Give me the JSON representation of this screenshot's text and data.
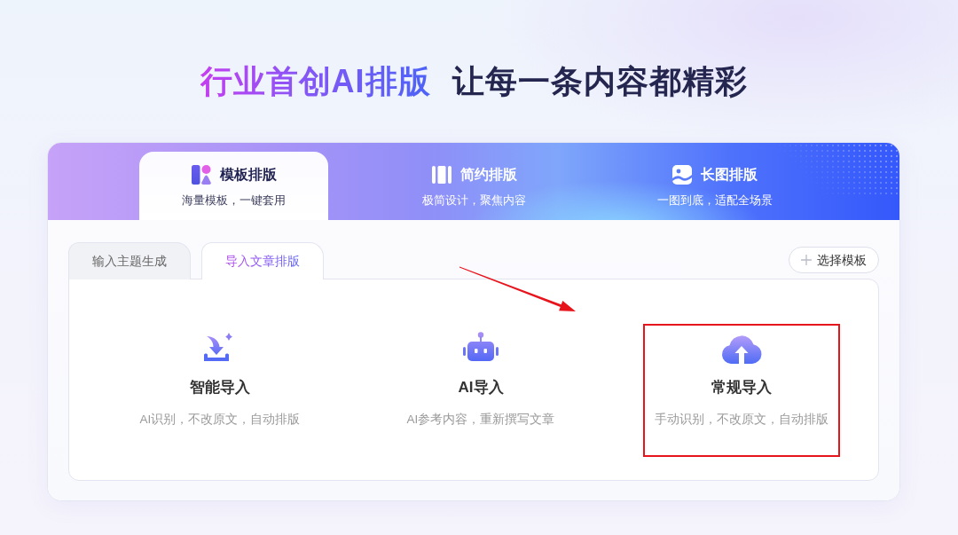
{
  "headline": {
    "accent": "行业首创AI排版",
    "text": "让每一条内容都精彩"
  },
  "layout_tabs": [
    {
      "title": "模板排版",
      "subtitle": "海量模板，一键套用",
      "selected": true
    },
    {
      "title": "简约排版",
      "subtitle": "极简设计，聚焦内容",
      "selected": false
    },
    {
      "title": "长图排版",
      "subtitle": "一图到底，适配全场景",
      "selected": false
    }
  ],
  "mode_tabs": [
    {
      "label": "输入主题生成",
      "selected": false
    },
    {
      "label": "导入文章排版",
      "selected": true
    }
  ],
  "select_template_button": {
    "label": "选择模板"
  },
  "import_options": [
    {
      "title": "智能导入",
      "description": "AI识别，不改原文，自动排版",
      "highlighted": false
    },
    {
      "title": "AI导入",
      "description": "AI参考内容，重新撰写文章",
      "highlighted": false
    },
    {
      "title": "常规导入",
      "description": "手动识别，不改原文，自动排版",
      "highlighted": true
    }
  ]
}
